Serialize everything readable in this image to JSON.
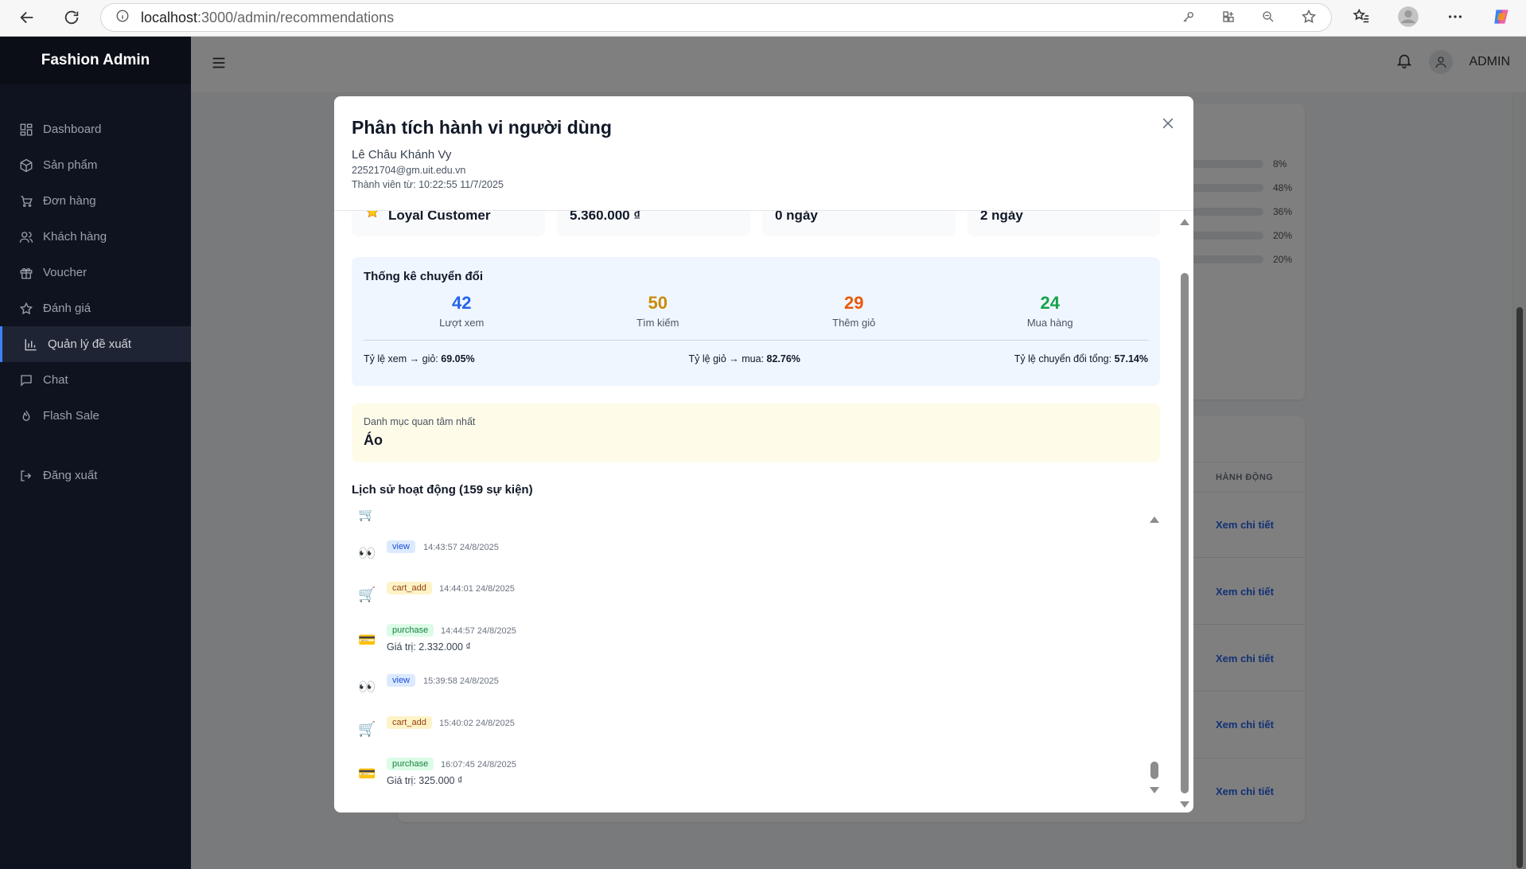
{
  "browser": {
    "url_host": "localhost",
    "url_path": ":3000/admin/recommendations"
  },
  "sidebar": {
    "brand": "Fashion Admin",
    "items": [
      {
        "label": "Dashboard",
        "icon": "dashboard-icon"
      },
      {
        "label": "Sản phẩm",
        "icon": "box-icon"
      },
      {
        "label": "Đơn hàng",
        "icon": "cart-icon"
      },
      {
        "label": "Khách hàng",
        "icon": "users-icon"
      },
      {
        "label": "Voucher",
        "icon": "gift-icon"
      },
      {
        "label": "Đánh giá",
        "icon": "star-icon"
      },
      {
        "label": "Quản lý đề xuất",
        "icon": "chart-icon",
        "active": true
      },
      {
        "label": "Chat",
        "icon": "chat-icon"
      },
      {
        "label": "Flash Sale",
        "icon": "flame-icon"
      }
    ],
    "logout": "Đăng xuất"
  },
  "header": {
    "user_label": "ADMIN"
  },
  "background": {
    "bars": [
      "8%",
      "48%",
      "36%",
      "20%",
      "20%"
    ],
    "action_header": "HÀNH ĐỘNG",
    "detail_link": "Xem chi tiết"
  },
  "modal": {
    "title": "Phân tích hành vi người dùng",
    "user_name": "Lê Châu Khánh Vy",
    "email": "22521704@gm.uit.edu.vn",
    "member_since": "Thành viên từ: 10:22:55 11/7/2025",
    "stats": {
      "segment": "Loyal Customer",
      "total_value": "5.360.000 ₫",
      "days_a": "0 ngày",
      "days_b": "2 ngày"
    },
    "conversion": {
      "title": "Thống kê chuyển đổi",
      "views": {
        "value": "42",
        "label": "Lượt xem",
        "color": "#2563eb"
      },
      "searches": {
        "value": "50",
        "label": "Tìm kiếm",
        "color": "#ca8a04"
      },
      "cart_adds": {
        "value": "29",
        "label": "Thêm giỏ",
        "color": "#ea580c"
      },
      "purchases": {
        "value": "24",
        "label": "Mua hàng",
        "color": "#16a34a"
      },
      "view_to_cart_label": "Tỷ lệ xem → giỏ:",
      "view_to_cart": "69.05%",
      "cart_to_buy_label": "Tỷ lệ giỏ → mua:",
      "cart_to_buy": "82.76%",
      "overall_label": "Tỷ lệ chuyển đổi tổng:",
      "overall": "57.14%"
    },
    "category": {
      "label": "Danh mục quan tâm nhất",
      "value": "Áo"
    },
    "history": {
      "title": "Lịch sử hoạt động (159 sự kiện)",
      "events": [
        {
          "type": "view",
          "time": "14:43:57 24/8/2025"
        },
        {
          "type": "cart_add",
          "time": "14:44:01 24/8/2025"
        },
        {
          "type": "purchase",
          "time": "14:44:57 24/8/2025",
          "value": "Giá trị: 2.332.000 ₫"
        },
        {
          "type": "view",
          "time": "15:39:58 24/8/2025"
        },
        {
          "type": "cart_add",
          "time": "15:40:02 24/8/2025"
        },
        {
          "type": "purchase",
          "time": "16:07:45 24/8/2025",
          "value": "Giá trị: 325.000 ₫"
        }
      ]
    }
  }
}
